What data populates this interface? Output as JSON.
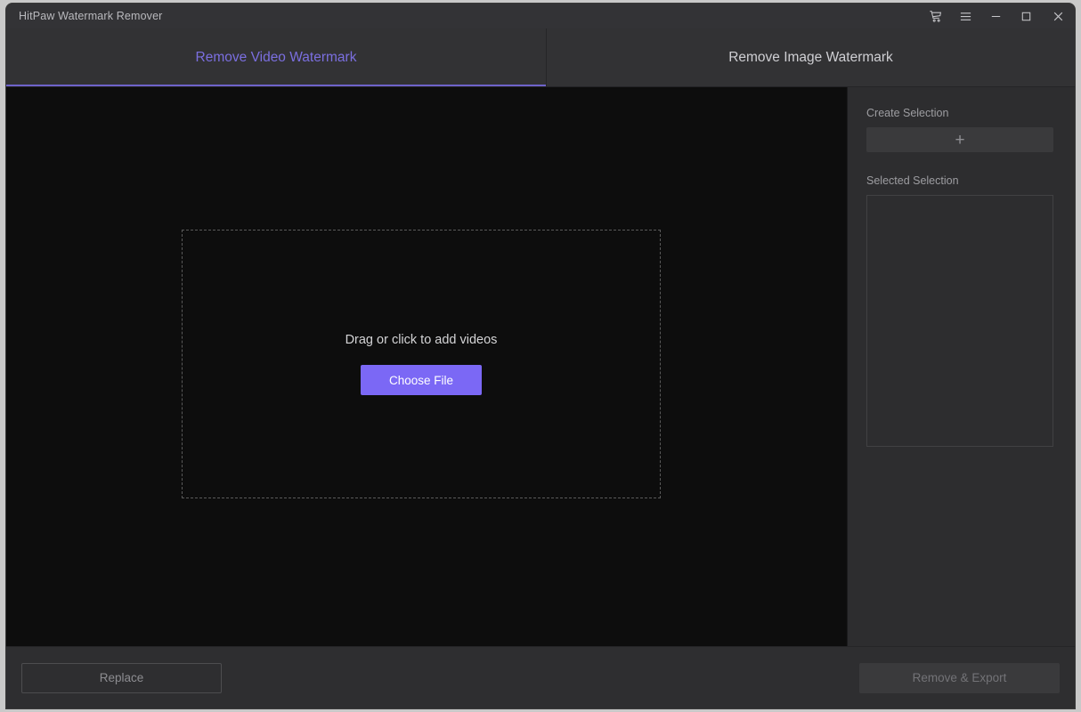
{
  "window": {
    "title": "HitPaw Watermark Remover",
    "controls": [
      {
        "name": "cart-icon",
        "label": "Store"
      },
      {
        "name": "menu-icon",
        "label": "Menu"
      },
      {
        "name": "minimize-icon",
        "label": "Minimize"
      },
      {
        "name": "maximize-icon",
        "label": "Maximize"
      },
      {
        "name": "close-icon",
        "label": "Close"
      }
    ]
  },
  "tabs": [
    {
      "label": "Remove Video Watermark",
      "active": true
    },
    {
      "label": "Remove Image Watermark",
      "active": false
    }
  ],
  "canvas": {
    "drop_zone_text": "Drag or click to add videos",
    "choose_file_label": "Choose File"
  },
  "sidebar": {
    "create_selection_label": "Create Selection",
    "create_selection_icon": "plus-icon",
    "create_selection_glyph": "+",
    "selected_selection_label": "Selected Selection",
    "selected_selection_items": []
  },
  "bottom_bar": {
    "replace_label": "Replace",
    "remove_export_label": "Remove & Export"
  },
  "colors": {
    "accent": "#7b68f5",
    "active_tab_text": "#7b6fe0",
    "window_background": "#2e2e2e",
    "canvas_background": "#0d0d0d",
    "sidebar_background": "#2d2d2f"
  }
}
